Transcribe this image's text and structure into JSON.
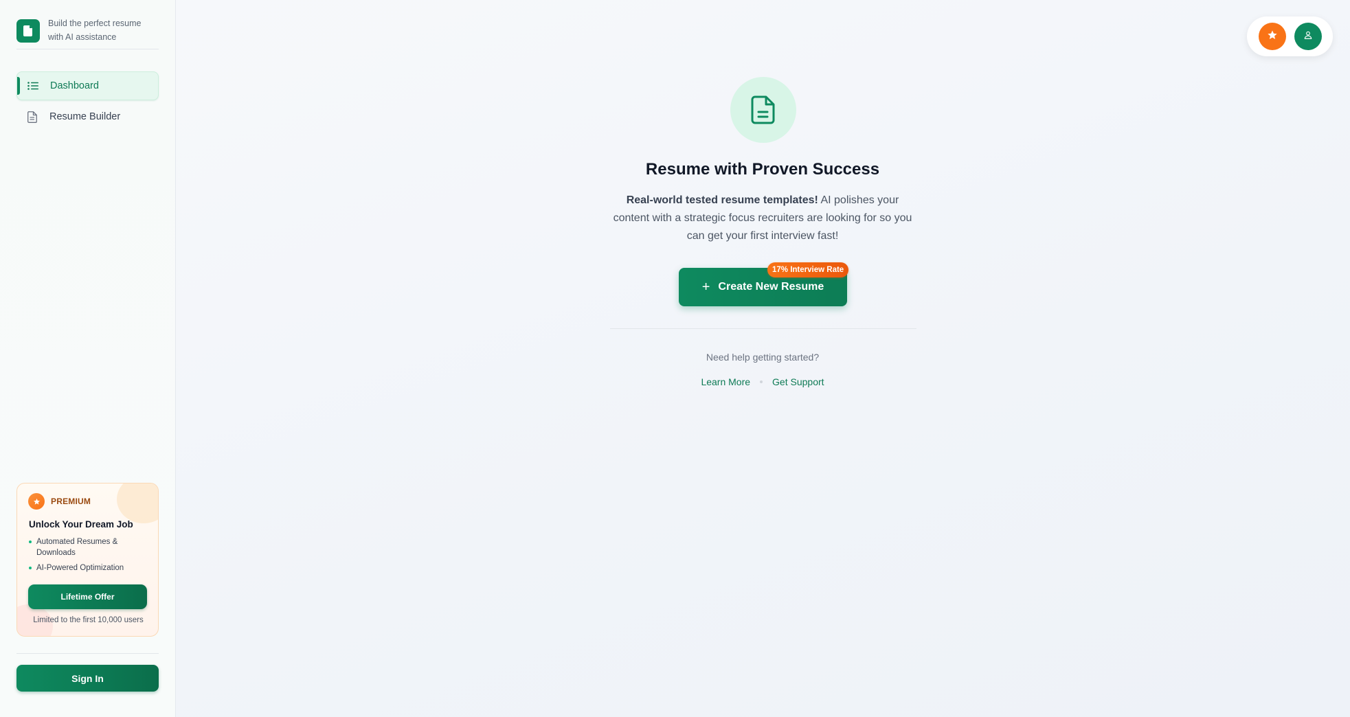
{
  "sidebar": {
    "brand": {
      "tagline": "Build the perfect resume with AI assistance",
      "logo_icon": "document-icon"
    },
    "nav": [
      {
        "label": "Dashboard",
        "icon": "list-icon",
        "active": true
      },
      {
        "label": "Resume Builder",
        "icon": "document-icon",
        "active": false
      }
    ],
    "premium": {
      "badge_icon": "star-icon",
      "label": "PREMIUM",
      "title": "Unlock Your Dream Job",
      "features": [
        "Automated Resumes & Downloads",
        "AI-Powered Optimization"
      ],
      "cta_label": "Lifetime Offer",
      "note": "Limited to the first 10,000 users"
    },
    "sign_in_label": "Sign In"
  },
  "topbar": {
    "buttons": [
      {
        "icon": "star-icon",
        "color": "#f97316"
      },
      {
        "icon": "user-icon",
        "color": "#0e8a5f"
      }
    ]
  },
  "hero": {
    "icon": "document-icon",
    "title": "Resume with Proven Success",
    "description_bold": "Real-world tested resume templates!",
    "description_rest": " AI polishes your content with a strategic focus recruiters are looking for so you can get your first interview fast!",
    "cta_label": "Create New Resume",
    "cta_icon": "plus-icon",
    "badge": "17% Interview Rate",
    "help_text": "Need help getting started?",
    "links": [
      "Learn More",
      "Get Support"
    ]
  },
  "colors": {
    "brand_green": "#0e8a5f",
    "accent_orange": "#f97316",
    "active_nav_bg": "#e6f7ef"
  }
}
